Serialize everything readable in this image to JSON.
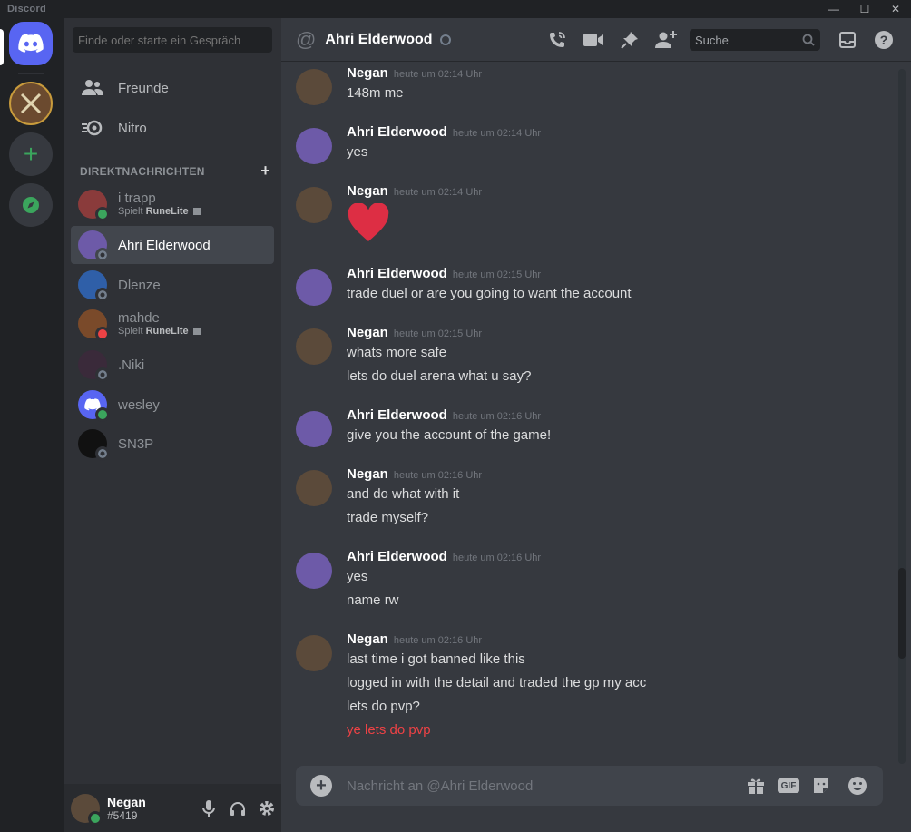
{
  "window": {
    "brand": "Discord",
    "controls": [
      "—",
      "☐",
      "✕"
    ]
  },
  "rail": {
    "home_icon": "discord-logo-icon",
    "servers": [
      "game-server-icon"
    ],
    "add_icon": "plus-icon",
    "explore_icon": "compass-icon"
  },
  "sidebar": {
    "search_placeholder": "Finde oder starte ein Gespräch",
    "nav": [
      {
        "label": "Freunde",
        "icon": "friends-icon"
      },
      {
        "label": "Nitro",
        "icon": "nitro-icon"
      }
    ],
    "dm_header": "DIREKTNACHRICHTEN",
    "dms": [
      {
        "name": "i trapp",
        "status": "online",
        "activity_prefix": "Spielt",
        "activity_game": "RuneLite",
        "avatar": "#8a3b3b"
      },
      {
        "name": "Ahri Elderwood",
        "status": "offline",
        "active": true,
        "avatar": "#6d5aa8"
      },
      {
        "name": "Dlenze",
        "status": "offline",
        "avatar": "#2f5fa8"
      },
      {
        "name": "mahde",
        "status": "dnd",
        "activity_prefix": "Spielt",
        "activity_game": "RuneLite",
        "avatar": "#7a4a2a"
      },
      {
        "name": ".Niki",
        "status": "offline",
        "avatar": "#3a2a3a"
      },
      {
        "name": "wesley",
        "status": "online",
        "avatar": "#5865f2"
      },
      {
        "name": "SN3P",
        "status": "offline",
        "avatar": "#111111"
      }
    ],
    "user": {
      "name": "Negan",
      "tag": "#5419"
    }
  },
  "header": {
    "title": "Ahri Elderwood",
    "search_placeholder": "Suche"
  },
  "messages": [
    {
      "author": "Negan",
      "time": "heute um 02:14 Uhr",
      "lines": [
        "148m me"
      ]
    },
    {
      "author": "Ahri Elderwood",
      "time": "heute um 02:14 Uhr",
      "lines": [
        "yes"
      ]
    },
    {
      "author": "Negan",
      "time": "heute um 02:14 Uhr",
      "lines": [],
      "emoji": "heart"
    },
    {
      "author": "Ahri Elderwood",
      "time": "heute um 02:15 Uhr",
      "lines": [
        "trade duel or are you going to want the account"
      ]
    },
    {
      "author": "Negan",
      "time": "heute um 02:15 Uhr",
      "lines": [
        "whats more safe",
        "lets do duel arena what u say?"
      ]
    },
    {
      "author": "Ahri Elderwood",
      "time": "heute um 02:16 Uhr",
      "lines": [
        "give you the account of the game!"
      ]
    },
    {
      "author": "Negan",
      "time": "heute um 02:16 Uhr",
      "lines": [
        "and do what with it",
        "trade myself?"
      ]
    },
    {
      "author": "Ahri Elderwood",
      "time": "heute um 02:16 Uhr",
      "lines": [
        "yes",
        "name rw"
      ]
    },
    {
      "author": "Negan",
      "time": "heute um 02:16 Uhr",
      "lines": [
        "last time i got banned like this",
        "logged in with the detail and traded the gp my acc",
        "lets do pvp?"
      ],
      "red_line": "ye lets do pvp"
    }
  ],
  "composer": {
    "placeholder": "Nachricht an @Ahri Elderwood"
  },
  "colors": {
    "accent": "#5865f2",
    "online": "#3ba55d",
    "dnd": "#ed4245",
    "mention_red": "#ed4245"
  }
}
